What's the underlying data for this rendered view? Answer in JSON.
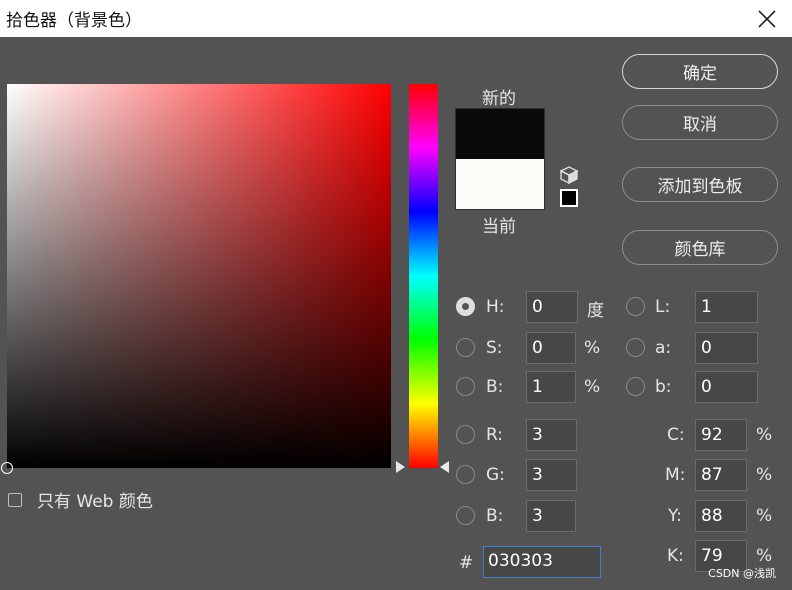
{
  "window": {
    "title": "拾色器（背景色）"
  },
  "preview": {
    "new_label": "新的",
    "current_label": "当前",
    "new_color": "#0a0a0a",
    "current_color": "#fcfcf8"
  },
  "buttons": {
    "ok": "确定",
    "cancel": "取消",
    "add_to_swatches": "添加到色板",
    "color_libraries": "颜色库"
  },
  "web_only": {
    "label": "只有 Web 颜色",
    "checked": false
  },
  "hsb": {
    "h": {
      "label": "H:",
      "value": "0",
      "unit": "度"
    },
    "s": {
      "label": "S:",
      "value": "0",
      "unit": "%"
    },
    "b": {
      "label": "B:",
      "value": "1",
      "unit": "%"
    }
  },
  "rgb": {
    "r": {
      "label": "R:",
      "value": "3"
    },
    "g": {
      "label": "G:",
      "value": "3"
    },
    "b": {
      "label": "B:",
      "value": "3"
    }
  },
  "lab": {
    "l": {
      "label": "L:",
      "value": "1"
    },
    "a": {
      "label": "a:",
      "value": "0"
    },
    "b": {
      "label": "b:",
      "value": "0"
    }
  },
  "cmyk": {
    "c": {
      "label": "C:",
      "value": "92",
      "unit": "%"
    },
    "m": {
      "label": "M:",
      "value": "87",
      "unit": "%"
    },
    "y": {
      "label": "Y:",
      "value": "88",
      "unit": "%"
    },
    "k": {
      "label": "K:",
      "value": "79",
      "unit": "%"
    }
  },
  "hex": {
    "label": "#",
    "value": "030303"
  },
  "watermark": "CSDN @浅凯"
}
